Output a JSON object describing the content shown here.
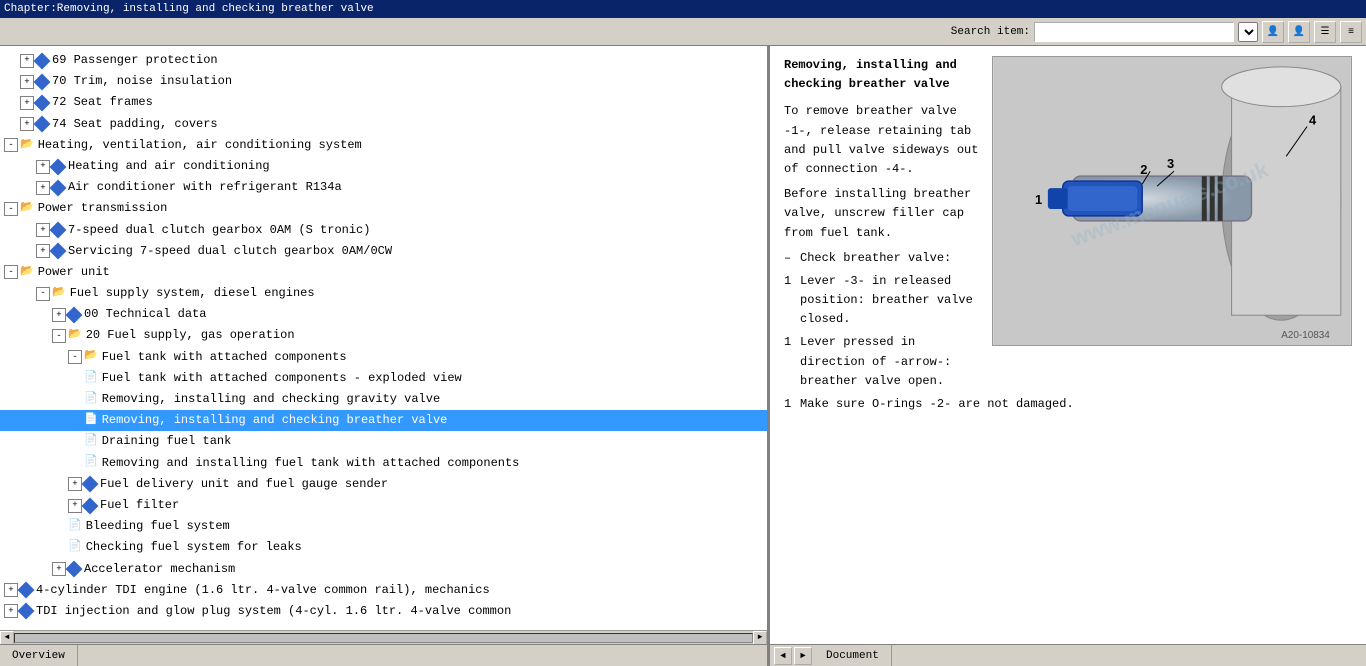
{
  "titleBar": {
    "text": "Chapter:Removing, installing and checking breather valve"
  },
  "toolbar": {
    "searchLabel": "Search item:",
    "searchPlaceholder": ""
  },
  "tree": {
    "items": [
      {
        "id": 1,
        "level": 1,
        "type": "diamond-expand",
        "label": "69 Passenger protection",
        "expanded": false
      },
      {
        "id": 2,
        "level": 1,
        "type": "diamond-expand",
        "label": "70 Trim, noise insulation",
        "expanded": false
      },
      {
        "id": 3,
        "level": 1,
        "type": "diamond-expand",
        "label": "72 Seat frames",
        "expanded": false
      },
      {
        "id": 4,
        "level": 1,
        "type": "diamond-expand",
        "label": "74 Seat padding, covers",
        "expanded": false
      },
      {
        "id": 5,
        "level": 0,
        "type": "folder-expand",
        "label": "Heating, ventilation, air conditioning system",
        "expanded": true
      },
      {
        "id": 6,
        "level": 1,
        "type": "diamond-expand",
        "label": "Heating and air conditioning",
        "expanded": false
      },
      {
        "id": 7,
        "level": 1,
        "type": "diamond-expand",
        "label": "Air conditioner with refrigerant R134a",
        "expanded": false
      },
      {
        "id": 8,
        "level": 0,
        "type": "folder-expand",
        "label": "Power transmission",
        "expanded": true
      },
      {
        "id": 9,
        "level": 1,
        "type": "diamond-expand",
        "label": "7-speed dual clutch gearbox 0AM (S tronic)",
        "expanded": false
      },
      {
        "id": 10,
        "level": 1,
        "type": "diamond-expand",
        "label": "Servicing 7-speed dual clutch gearbox 0AM/0CW",
        "expanded": false
      },
      {
        "id": 11,
        "level": 0,
        "type": "folder-expand",
        "label": "Power unit",
        "expanded": true
      },
      {
        "id": 12,
        "level": 1,
        "type": "folder-expand",
        "label": "Fuel supply system, diesel engines",
        "expanded": true
      },
      {
        "id": 13,
        "level": 2,
        "type": "diamond-expand",
        "label": "00 Technical data",
        "expanded": false
      },
      {
        "id": 14,
        "level": 2,
        "type": "folder-expand",
        "label": "20 Fuel supply, gas operation",
        "expanded": true
      },
      {
        "id": 15,
        "level": 3,
        "type": "folder-expand",
        "label": "Fuel tank with attached components",
        "expanded": true
      },
      {
        "id": 16,
        "level": 4,
        "type": "doc",
        "label": "Fuel tank with attached components - exploded view",
        "selected": false
      },
      {
        "id": 17,
        "level": 4,
        "type": "doc",
        "label": "Removing, installing and checking gravity valve",
        "selected": false
      },
      {
        "id": 18,
        "level": 4,
        "type": "doc",
        "label": "Removing, installing and checking breather valve",
        "selected": true
      },
      {
        "id": 19,
        "level": 4,
        "type": "doc",
        "label": "Draining fuel tank",
        "selected": false
      },
      {
        "id": 20,
        "level": 4,
        "type": "doc",
        "label": "Removing and installing fuel tank with attached components",
        "selected": false
      },
      {
        "id": 21,
        "level": 3,
        "type": "diamond-expand",
        "label": "Fuel delivery unit and fuel gauge sender",
        "expanded": false
      },
      {
        "id": 22,
        "level": 3,
        "type": "diamond-expand",
        "label": "Fuel filter",
        "expanded": false
      },
      {
        "id": 23,
        "level": 3,
        "type": "plain",
        "label": "Bleeding fuel system",
        "selected": false
      },
      {
        "id": 24,
        "level": 3,
        "type": "plain",
        "label": "Checking fuel system for leaks",
        "selected": false
      },
      {
        "id": 25,
        "level": 2,
        "type": "diamond-expand",
        "label": "Accelerator mechanism",
        "expanded": false
      },
      {
        "id": 26,
        "level": 0,
        "type": "diamond-expand",
        "label": "4-cylinder TDI engine (1.6 ltr. 4-valve common rail), mechanics",
        "expanded": false
      },
      {
        "id": 27,
        "level": 0,
        "type": "diamond-expand",
        "label": "TDI injection and glow plug system (4-cyl. 1.6 ltr. 4-valve common",
        "expanded": false
      }
    ]
  },
  "document": {
    "title": "Removing, installing and\nchecking breather valve",
    "imageRef": "A20-10834",
    "watermark": "www.manuals.co.uk",
    "content": [
      {
        "type": "para",
        "text": "To remove breather valve -1-, release retaining tab and pull valve sideways out of connection -4-."
      },
      {
        "type": "para",
        "text": "Before installing breather valve, unscrew filler cap from fuel tank."
      },
      {
        "type": "bullet",
        "symbol": "–",
        "text": "Check breather valve:"
      },
      {
        "type": "numbered",
        "num": "1",
        "text": "Lever -3- in released position: breather valve closed."
      },
      {
        "type": "numbered",
        "num": "1",
        "text": "Lever pressed in direction of -arrow-: breather valve open."
      },
      {
        "type": "numbered",
        "num": "1",
        "text": "Make sure O-rings -2- are not damaged."
      }
    ]
  },
  "statusBar": {
    "leftTab": "Overview",
    "rightTab": "Document"
  },
  "icons": {
    "expand": "+",
    "collapse": "-",
    "folder": "📁",
    "doc": "📄",
    "arrowLeft": "◄",
    "arrowRight": "►",
    "scrollLeft": "◄",
    "scrollRight": "►",
    "navPrev": "◄",
    "navNext": "►",
    "userIcon": "👤",
    "menuIcon": "☰"
  }
}
